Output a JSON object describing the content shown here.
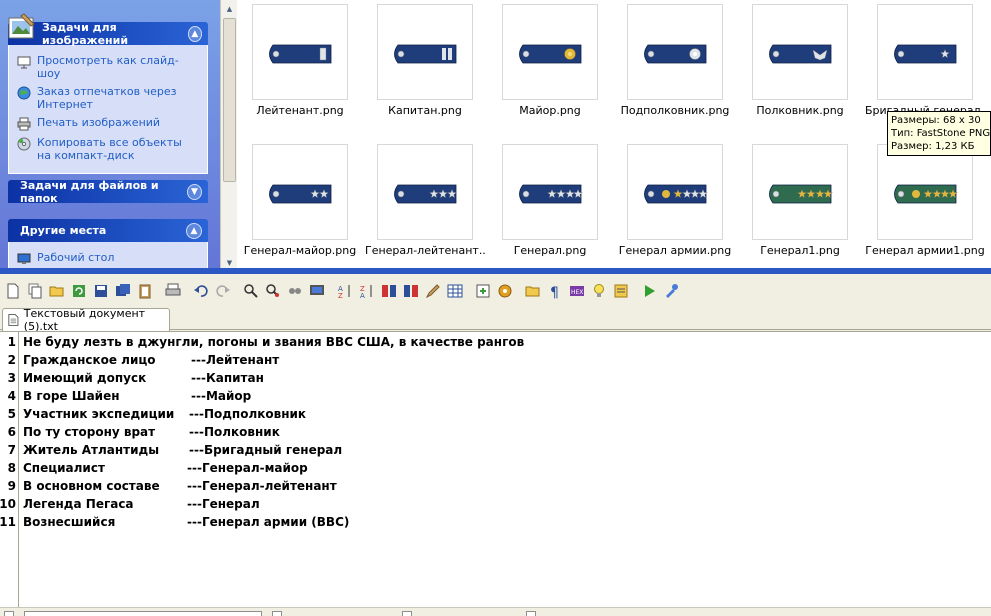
{
  "explorer": {
    "task_groups": [
      {
        "title": "Задачи для изображений",
        "tasks": [
          "Просмотреть как слайд-шоу",
          "Заказ отпечатков через Интернет",
          "Печать изображений",
          "Копировать все объекты на компакт-диск"
        ]
      },
      {
        "title": "Задачи для файлов и папок",
        "tasks": []
      },
      {
        "title": "Другие места",
        "tasks": [
          "Рабочий стол"
        ]
      }
    ],
    "thumbnails": [
      {
        "name": "Лейтенант.png",
        "insignia": "one-bar-silver",
        "board_color": "#1f3d7a"
      },
      {
        "name": "Капитан.png",
        "insignia": "two-bars-silver",
        "board_color": "#1f3d7a"
      },
      {
        "name": "Майор.png",
        "insignia": "gold-leaf",
        "board_color": "#1f3d7a"
      },
      {
        "name": "Подполковник.png",
        "insignia": "silver-leaf",
        "board_color": "#1f3d7a"
      },
      {
        "name": "Полковник.png",
        "insignia": "eagle",
        "board_color": "#1f3d7a"
      },
      {
        "name": "Бригадный генерал.png",
        "insignia": "1-star",
        "board_color": "#1f3d7a"
      },
      {
        "name": "Генерал-майор.png",
        "insignia": "2-stars",
        "board_color": "#1f3d7a"
      },
      {
        "name": "Генерал-лейтенант....",
        "insignia": "3-stars",
        "board_color": "#1f3d7a"
      },
      {
        "name": "Генерал.png",
        "insignia": "4-stars",
        "board_color": "#1f3d7a"
      },
      {
        "name": "Генерал армии.png",
        "insignia": "5-stars-gold",
        "board_color": "#1f3d7a"
      },
      {
        "name": "Генерал1.png",
        "insignia": "4-stars-green",
        "board_color": "#2e6b4f"
      },
      {
        "name": "Генерал армии1.png",
        "insignia": "5-stars-green",
        "board_color": "#2e6b4f"
      }
    ],
    "tooltip": {
      "size": "Размеры: 68 x 30",
      "type": "Тип: FastStone PNG",
      "file_size": "Размер: 1,23 КБ"
    }
  },
  "editor": {
    "tab_title": "Текстовый документ (5).txt",
    "lines": [
      {
        "n": "1",
        "left": "Не буду лезть в джунгли, погоны и звания ВВС США, в качестве рангов",
        "right": ""
      },
      {
        "n": "2",
        "left": "Гражданское лицо",
        "right": "---Лейтенант"
      },
      {
        "n": "3",
        "left": "Имеющий допуск",
        "right": "---Капитан"
      },
      {
        "n": "4",
        "left": "В горе Шайен",
        "right": "---Майор"
      },
      {
        "n": "5",
        "left": "Участник экспедиции",
        "right": "---Подполковник"
      },
      {
        "n": "6",
        "left": "По ту сторону врат",
        "right": "---Полковник"
      },
      {
        "n": "7",
        "left": "Житель Атлантиды",
        "right": "---Бригадный генерал"
      },
      {
        "n": "8",
        "left": "Специалист",
        "right": "---Генерал-майор"
      },
      {
        "n": "9",
        "left": "В основном составе",
        "right": "---Генерал-лейтенант"
      },
      {
        "n": "10",
        "left": "Легенда Пегаса",
        "right": "---Генерал"
      },
      {
        "n": "11",
        "left": "Вознесшийся",
        "right": "---Генерал армии (ВВС)"
      }
    ],
    "toolbar_icons": [
      "new-document-icon",
      "copy-icon",
      "open-folder-icon",
      "refresh-icon",
      "save-icon",
      "save-all-icon",
      "clipboard-icon",
      "print-icon",
      "undo-icon",
      "redo-icon",
      "find-icon",
      "find-replace-icon",
      "view-icon",
      "monitor-icon",
      "sort-ascending-icon",
      "sort-descending-icon",
      "tile-horizontal-icon",
      "tile-vertical-icon",
      "edit-icon",
      "grid-icon",
      "insert-icon",
      "settings-gear-icon",
      "folder-icon",
      "pilcrow-icon",
      "hex-icon",
      "lightbulb-icon",
      "notes-icon",
      "run-icon",
      "tools-icon"
    ]
  }
}
